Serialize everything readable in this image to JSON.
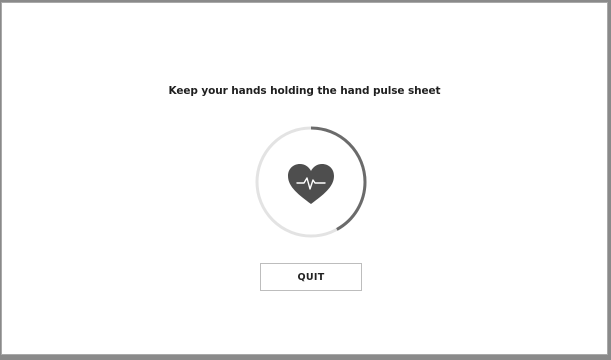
{
  "screen": {
    "instruction": "Keep your hands holding the hand pulse sheet",
    "quit_label": "QUIT"
  },
  "pulse_progress": {
    "fraction": 0.42,
    "track_color": "#e3e3e3",
    "fill_color": "#6b6b6b"
  },
  "icons": {
    "center_icon": "heart-pulse-icon"
  },
  "colors": {
    "heart": "#4e4e4e",
    "pulse_line": "#ffffff"
  }
}
